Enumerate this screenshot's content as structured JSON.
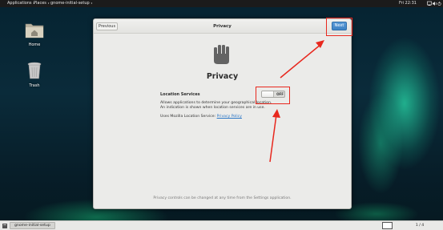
{
  "top_bar": {
    "applications": "Applications",
    "places": "Places",
    "app_name": "gnome-initial-setup",
    "clock": "Fri 22:31"
  },
  "desktop_icons": {
    "home": "Home",
    "trash": "Trash"
  },
  "dialog": {
    "title": "Privacy",
    "previous_button": "Previous",
    "next_button": "Next",
    "heading": "Privacy",
    "location_services_label": "Location Services",
    "location_toggle": {
      "state": "OFF",
      "enabled": false
    },
    "description": "Allows applications to determine your geographical location. An indication is shown when location services are in use.",
    "mozilla_text": "Uses Mozilla Location Service:",
    "privacy_policy_link": "Privacy Policy",
    "footer_note": "Privacy controls can be changed at any time from the Settings application."
  },
  "taskbar": {
    "window_item": "gnome-initial-setup",
    "workspace_counter": "1 / 4"
  },
  "colors": {
    "annotation_red": "#e8281e",
    "next_button_blue": "#3f82c5",
    "link_blue": "#2a76c6"
  },
  "icons": [
    "home-folder-icon",
    "trash-icon",
    "hand-stop-icon",
    "network-icon",
    "volume-icon",
    "power-icon",
    "window-list-icon"
  ]
}
